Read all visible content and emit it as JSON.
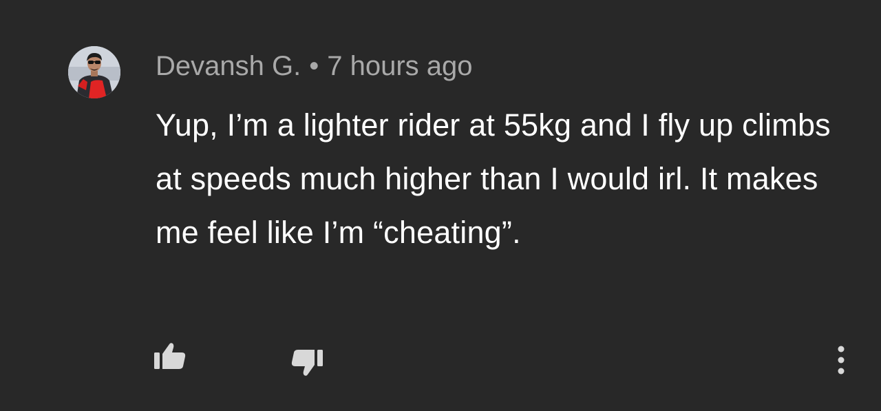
{
  "comment": {
    "author": "Devansh G.",
    "separator": "•",
    "timestamp": "7 hours ago",
    "text": "Yup, I’m a lighter rider at 55kg and I fly up climbs at speeds much higher than I would irl. It makes me feel like I’m “cheating”."
  },
  "actions": {
    "like_icon": "thumbs-up-icon",
    "dislike_icon": "thumbs-down-icon",
    "more_icon": "more-vertical-icon"
  },
  "colors": {
    "background": "#282828",
    "text": "#ffffff",
    "meta": "#a9a9a9",
    "icon": "#d8d8d8"
  }
}
